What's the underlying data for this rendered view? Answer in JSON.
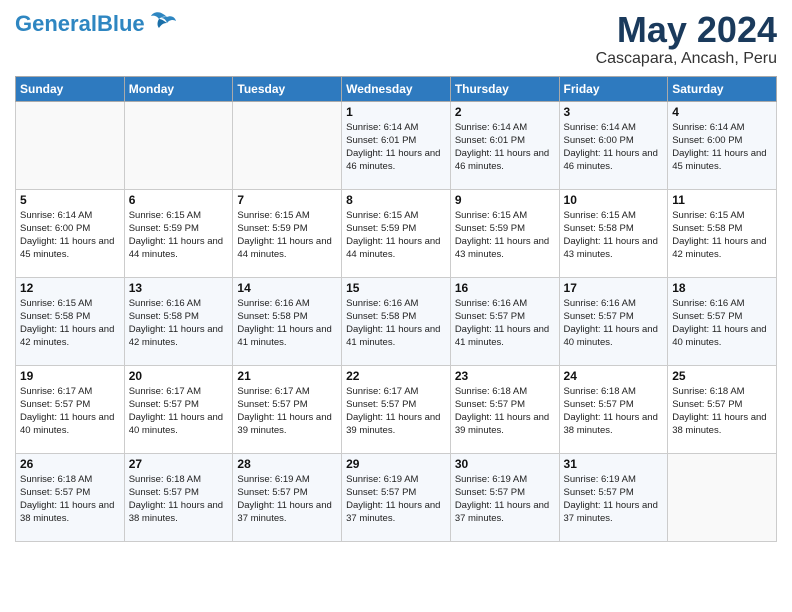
{
  "header": {
    "logo_general": "General",
    "logo_blue": "Blue",
    "month_title": "May 2024",
    "location": "Cascapara, Ancash, Peru"
  },
  "weekdays": [
    "Sunday",
    "Monday",
    "Tuesday",
    "Wednesday",
    "Thursday",
    "Friday",
    "Saturday"
  ],
  "weeks": [
    [
      {
        "day": "",
        "sunrise": "",
        "sunset": "",
        "daylight": ""
      },
      {
        "day": "",
        "sunrise": "",
        "sunset": "",
        "daylight": ""
      },
      {
        "day": "",
        "sunrise": "",
        "sunset": "",
        "daylight": ""
      },
      {
        "day": "1",
        "sunrise": "Sunrise: 6:14 AM",
        "sunset": "Sunset: 6:01 PM",
        "daylight": "Daylight: 11 hours and 46 minutes."
      },
      {
        "day": "2",
        "sunrise": "Sunrise: 6:14 AM",
        "sunset": "Sunset: 6:01 PM",
        "daylight": "Daylight: 11 hours and 46 minutes."
      },
      {
        "day": "3",
        "sunrise": "Sunrise: 6:14 AM",
        "sunset": "Sunset: 6:00 PM",
        "daylight": "Daylight: 11 hours and 46 minutes."
      },
      {
        "day": "4",
        "sunrise": "Sunrise: 6:14 AM",
        "sunset": "Sunset: 6:00 PM",
        "daylight": "Daylight: 11 hours and 45 minutes."
      }
    ],
    [
      {
        "day": "5",
        "sunrise": "Sunrise: 6:14 AM",
        "sunset": "Sunset: 6:00 PM",
        "daylight": "Daylight: 11 hours and 45 minutes."
      },
      {
        "day": "6",
        "sunrise": "Sunrise: 6:15 AM",
        "sunset": "Sunset: 5:59 PM",
        "daylight": "Daylight: 11 hours and 44 minutes."
      },
      {
        "day": "7",
        "sunrise": "Sunrise: 6:15 AM",
        "sunset": "Sunset: 5:59 PM",
        "daylight": "Daylight: 11 hours and 44 minutes."
      },
      {
        "day": "8",
        "sunrise": "Sunrise: 6:15 AM",
        "sunset": "Sunset: 5:59 PM",
        "daylight": "Daylight: 11 hours and 44 minutes."
      },
      {
        "day": "9",
        "sunrise": "Sunrise: 6:15 AM",
        "sunset": "Sunset: 5:59 PM",
        "daylight": "Daylight: 11 hours and 43 minutes."
      },
      {
        "day": "10",
        "sunrise": "Sunrise: 6:15 AM",
        "sunset": "Sunset: 5:58 PM",
        "daylight": "Daylight: 11 hours and 43 minutes."
      },
      {
        "day": "11",
        "sunrise": "Sunrise: 6:15 AM",
        "sunset": "Sunset: 5:58 PM",
        "daylight": "Daylight: 11 hours and 42 minutes."
      }
    ],
    [
      {
        "day": "12",
        "sunrise": "Sunrise: 6:15 AM",
        "sunset": "Sunset: 5:58 PM",
        "daylight": "Daylight: 11 hours and 42 minutes."
      },
      {
        "day": "13",
        "sunrise": "Sunrise: 6:16 AM",
        "sunset": "Sunset: 5:58 PM",
        "daylight": "Daylight: 11 hours and 42 minutes."
      },
      {
        "day": "14",
        "sunrise": "Sunrise: 6:16 AM",
        "sunset": "Sunset: 5:58 PM",
        "daylight": "Daylight: 11 hours and 41 minutes."
      },
      {
        "day": "15",
        "sunrise": "Sunrise: 6:16 AM",
        "sunset": "Sunset: 5:58 PM",
        "daylight": "Daylight: 11 hours and 41 minutes."
      },
      {
        "day": "16",
        "sunrise": "Sunrise: 6:16 AM",
        "sunset": "Sunset: 5:57 PM",
        "daylight": "Daylight: 11 hours and 41 minutes."
      },
      {
        "day": "17",
        "sunrise": "Sunrise: 6:16 AM",
        "sunset": "Sunset: 5:57 PM",
        "daylight": "Daylight: 11 hours and 40 minutes."
      },
      {
        "day": "18",
        "sunrise": "Sunrise: 6:16 AM",
        "sunset": "Sunset: 5:57 PM",
        "daylight": "Daylight: 11 hours and 40 minutes."
      }
    ],
    [
      {
        "day": "19",
        "sunrise": "Sunrise: 6:17 AM",
        "sunset": "Sunset: 5:57 PM",
        "daylight": "Daylight: 11 hours and 40 minutes."
      },
      {
        "day": "20",
        "sunrise": "Sunrise: 6:17 AM",
        "sunset": "Sunset: 5:57 PM",
        "daylight": "Daylight: 11 hours and 40 minutes."
      },
      {
        "day": "21",
        "sunrise": "Sunrise: 6:17 AM",
        "sunset": "Sunset: 5:57 PM",
        "daylight": "Daylight: 11 hours and 39 minutes."
      },
      {
        "day": "22",
        "sunrise": "Sunrise: 6:17 AM",
        "sunset": "Sunset: 5:57 PM",
        "daylight": "Daylight: 11 hours and 39 minutes."
      },
      {
        "day": "23",
        "sunrise": "Sunrise: 6:18 AM",
        "sunset": "Sunset: 5:57 PM",
        "daylight": "Daylight: 11 hours and 39 minutes."
      },
      {
        "day": "24",
        "sunrise": "Sunrise: 6:18 AM",
        "sunset": "Sunset: 5:57 PM",
        "daylight": "Daylight: 11 hours and 38 minutes."
      },
      {
        "day": "25",
        "sunrise": "Sunrise: 6:18 AM",
        "sunset": "Sunset: 5:57 PM",
        "daylight": "Daylight: 11 hours and 38 minutes."
      }
    ],
    [
      {
        "day": "26",
        "sunrise": "Sunrise: 6:18 AM",
        "sunset": "Sunset: 5:57 PM",
        "daylight": "Daylight: 11 hours and 38 minutes."
      },
      {
        "day": "27",
        "sunrise": "Sunrise: 6:18 AM",
        "sunset": "Sunset: 5:57 PM",
        "daylight": "Daylight: 11 hours and 38 minutes."
      },
      {
        "day": "28",
        "sunrise": "Sunrise: 6:19 AM",
        "sunset": "Sunset: 5:57 PM",
        "daylight": "Daylight: 11 hours and 37 minutes."
      },
      {
        "day": "29",
        "sunrise": "Sunrise: 6:19 AM",
        "sunset": "Sunset: 5:57 PM",
        "daylight": "Daylight: 11 hours and 37 minutes."
      },
      {
        "day": "30",
        "sunrise": "Sunrise: 6:19 AM",
        "sunset": "Sunset: 5:57 PM",
        "daylight": "Daylight: 11 hours and 37 minutes."
      },
      {
        "day": "31",
        "sunrise": "Sunrise: 6:19 AM",
        "sunset": "Sunset: 5:57 PM",
        "daylight": "Daylight: 11 hours and 37 minutes."
      },
      {
        "day": "",
        "sunrise": "",
        "sunset": "",
        "daylight": ""
      }
    ]
  ]
}
